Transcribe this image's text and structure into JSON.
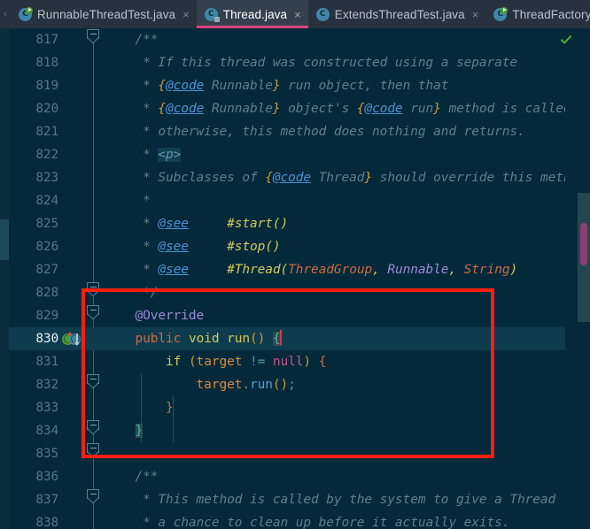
{
  "window": {
    "application": "IntelliJ IDEA",
    "theme_background": "#04293a",
    "accent_active_tab_underline": "#d9457f",
    "annotation_color": "#fe1f10"
  },
  "tabbar": {
    "scroll_left_glyph": "‹",
    "overflow_glyph": "⌄",
    "close_glyph": "×",
    "tabs": [
      {
        "label": "RunnableThreadTest.java",
        "icon": "java-class-runnable-icon",
        "active": false,
        "closable": true
      },
      {
        "label": "Thread.java",
        "icon": "java-class-file-icon",
        "active": true,
        "closable": true
      },
      {
        "label": "ExtendsThreadTest.java",
        "icon": "java-class-icon",
        "active": false,
        "closable": true
      },
      {
        "label": "ThreadFactoryTe",
        "icon": "java-class-runnable-icon",
        "active": false,
        "closable": false
      }
    ]
  },
  "editor": {
    "file": "Thread.java",
    "first_visible_line": 817,
    "current_line": 830,
    "inspection_status": "ok-check-icon",
    "gutter_icons": {
      "line_830": [
        {
          "name": "implementing-method-icon",
          "color": "#4a9b35",
          "direction": "up"
        },
        {
          "name": "overriding-method-icon",
          "color": "#3f86a8",
          "direction": "down"
        }
      ]
    },
    "lines": [
      {
        "num": 817,
        "text": "    /**"
      },
      {
        "num": 818,
        "text": "     * If this thread was constructed using a separate"
      },
      {
        "num": 819,
        "text": "     * {@code Runnable} run object, then that"
      },
      {
        "num": 820,
        "text": "     * {@code Runnable} object's {@code run} method is called;"
      },
      {
        "num": 821,
        "text": "     * otherwise, this method does nothing and returns."
      },
      {
        "num": 822,
        "text": "     * <p>"
      },
      {
        "num": 823,
        "text": "     * Subclasses of {@code Thread} should override this method."
      },
      {
        "num": 824,
        "text": "     *"
      },
      {
        "num": 825,
        "text": "     * @see     #start()"
      },
      {
        "num": 826,
        "text": "     * @see     #stop()"
      },
      {
        "num": 827,
        "text": "     * @see     #Thread(ThreadGroup, Runnable, String)"
      },
      {
        "num": 828,
        "text": "     */"
      },
      {
        "num": 829,
        "text": "    @Override"
      },
      {
        "num": 830,
        "text": "    public void run() {"
      },
      {
        "num": 831,
        "text": "        if (target != null) {"
      },
      {
        "num": 832,
        "text": "            target.run();"
      },
      {
        "num": 833,
        "text": "        }"
      },
      {
        "num": 834,
        "text": "    }"
      },
      {
        "num": 835,
        "text": ""
      },
      {
        "num": 836,
        "text": "    /**"
      },
      {
        "num": 837,
        "text": "     * This method is called by the system to give a Thread"
      },
      {
        "num": 838,
        "text": "     * a chance to clean up before it actually exits."
      }
    ]
  },
  "scrollbar": {
    "thumb_color": "#8e3f72",
    "region_color": "#23474f"
  }
}
